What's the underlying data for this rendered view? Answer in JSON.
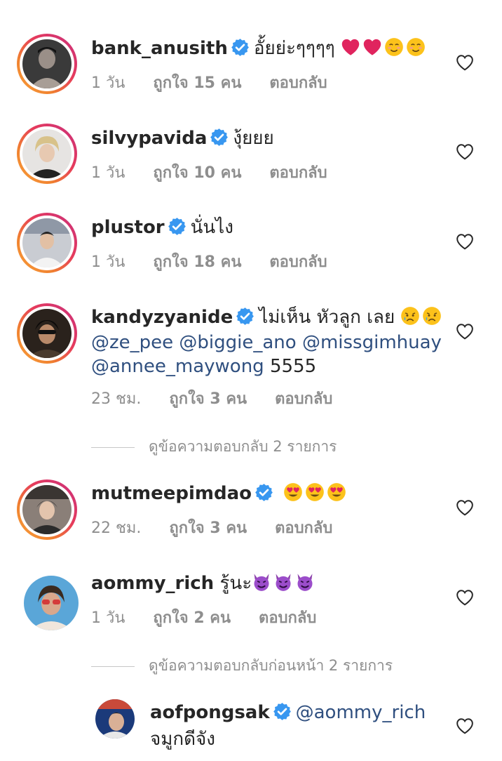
{
  "comments": [
    {
      "username": "bank_anusith",
      "text": "อั้ยย่ะๆๆๆๆ",
      "emojis": [
        "❤️",
        "❤️",
        "☺️",
        "☺️"
      ],
      "time": "1 วัน",
      "likes": "ถูกใจ 15 คน",
      "reply": "ตอบกลับ"
    },
    {
      "username": "silvypavida",
      "text": "งุ้ยยย",
      "time": "1 วัน",
      "likes": "ถูกใจ 10 คน",
      "reply": "ตอบกลับ"
    },
    {
      "username": "plustor",
      "text": "นั่นไง",
      "time": "1 วัน",
      "likes": "ถูกใจ 18 คน",
      "reply": "ตอบกลับ"
    },
    {
      "username": "kandyzyanide",
      "text": "ไม่เห็น หัวลูก เลย",
      "emojis": [
        "😢",
        "😢"
      ],
      "mentions": [
        "@ze_pee",
        "@biggie_ano",
        "@missgimhuay",
        "@annee_maywong"
      ],
      "trailing": "5555",
      "time": "23 ชม.",
      "likes": "ถูกใจ 3 คน",
      "reply": "ตอบกลับ"
    },
    {
      "username": "mutmeepimdao",
      "text": "",
      "emojis": [
        "😍",
        "😍",
        "😍"
      ],
      "time": "22 ชม.",
      "likes": "ถูกใจ 3 คน",
      "reply": "ตอบกลับ"
    },
    {
      "username": "aommy_rich",
      "text": "รู้นะ",
      "emojis": [
        "😈",
        "😈",
        "😈"
      ],
      "time": "1 วัน",
      "likes": "ถูกใจ 2 คน",
      "reply": "ตอบกลับ"
    },
    {
      "username": "aofpongsak",
      "mention": "@aommy_rich",
      "text": "จมูกดีจัง"
    }
  ],
  "view_replies_1": "ดูข้อความตอบกลับ 2 รายการ",
  "view_replies_2": "ดูข้อความตอบกลับก่อนหน้า 2 รายการ",
  "colors": {
    "text": "#262626",
    "meta": "#8e8e8e",
    "mention": "#2f4f7f",
    "verified": "#3897f0"
  }
}
